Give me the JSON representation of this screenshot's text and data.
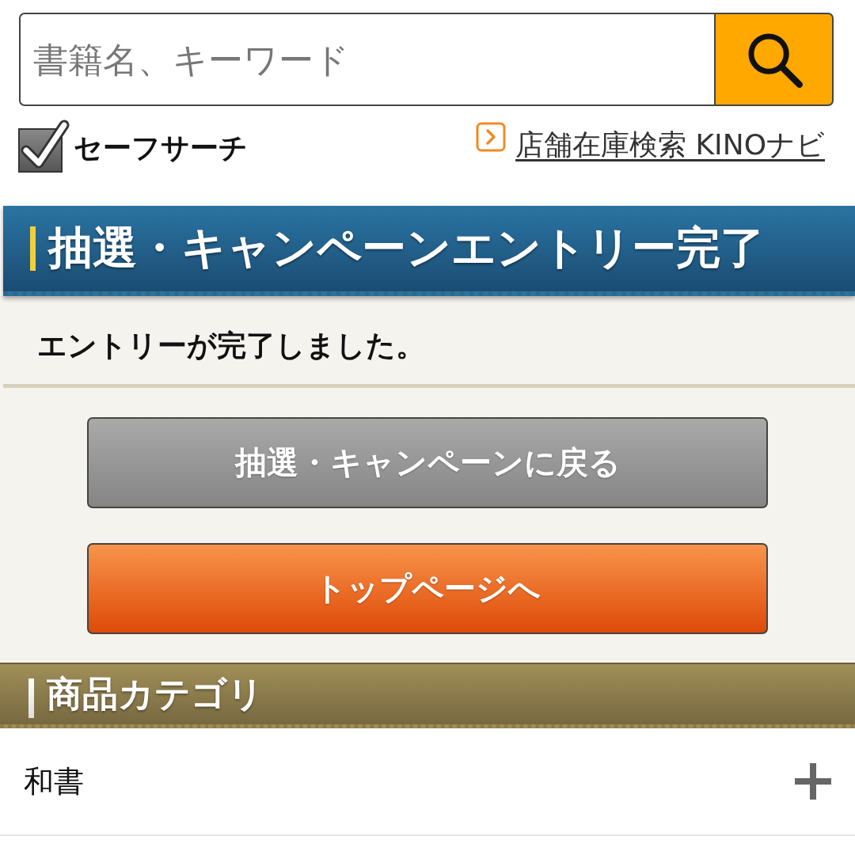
{
  "search": {
    "placeholder": "書籍名、キーワード"
  },
  "safe_search": {
    "label": "セーフサーチ",
    "checked": true
  },
  "store_link": {
    "label": "店舗在庫検索 KINOナビ"
  },
  "page_heading": {
    "title": "抽選・キャンペーンエントリー完了"
  },
  "message": "エントリーが完了しました。",
  "buttons": [
    {
      "label": "抽選・キャンペーンに戻る",
      "kind": "secondary"
    },
    {
      "label": "トップページへ",
      "kind": "primary"
    }
  ],
  "category_section": {
    "title": "商品カテゴリ",
    "items": [
      {
        "label": "和書",
        "expanded": false
      }
    ]
  }
}
